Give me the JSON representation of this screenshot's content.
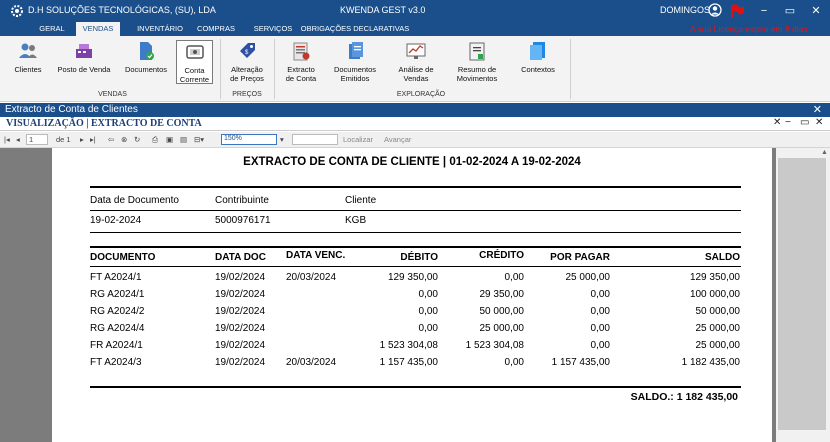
{
  "titlebar": {
    "company": "D.H SOLUÇÕES TECNOLÓGICAS, (SU), LDA",
    "app": "KWENDA GEST v3.0",
    "user": "DOMINGOS",
    "minimize": "−",
    "restore": "▭",
    "close": "✕"
  },
  "menu": {
    "tabs": [
      "GERAL",
      "VENDAS",
      "INVENTÁRIO",
      "COMPRAS",
      "SERVIÇOS",
      "OBRIGAÇÕES DECLARATIVAS"
    ],
    "active": "VENDAS",
    "license_warning": "A sua Licença expira em 8 dias"
  },
  "ribbon": {
    "buttons": [
      {
        "label": "Clientes",
        "icon": "users-icon"
      },
      {
        "label": "Posto de Venda",
        "icon": "cash-register-icon"
      },
      {
        "label": "Documentos",
        "icon": "document-check-icon"
      },
      {
        "label": "Conta\nCorrente",
        "icon": "current-account-icon"
      },
      {
        "label": "Alteração\nde Preços",
        "icon": "price-tag-icon"
      },
      {
        "label": "Extracto\nde Conta",
        "icon": "account-statement-icon"
      },
      {
        "label": "Documentos\nEmitidos",
        "icon": "issued-documents-icon"
      },
      {
        "label": "Análise de\nVendas",
        "icon": "sales-chart-icon"
      },
      {
        "label": "Resumo de\nMovimentos",
        "icon": "movements-summary-icon"
      },
      {
        "label": "Contextos",
        "icon": "contexts-icon"
      }
    ],
    "groups": [
      "VENDAS",
      "PREÇOS",
      "EXPLORAÇÃO"
    ]
  },
  "document_window": {
    "title": "Extracto de Conta de Clientes",
    "view_title": "VISUALIZAÇÃO | EXTRACTO DE CONTA",
    "close": "✕",
    "view_controls": [
      "✕",
      "−",
      "▭",
      "✕"
    ]
  },
  "report_toolbar": {
    "page_value": "1",
    "page_of": "de 1",
    "zoom": "150%",
    "find_label": "Localizar",
    "next_label": "Avançar"
  },
  "report": {
    "title": "EXTRACTO DE CONTA DE CLIENTE | 01-02-2024 A 19-02-2024",
    "info_headers": [
      "Data de Documento",
      "Contribuinte",
      "Cliente"
    ],
    "info_values": [
      "19-02-2024",
      "5000976171",
      "KGB"
    ],
    "columns": [
      "DOCUMENTO",
      "DATA DOC",
      "DATA VENC.",
      "DÉBITO",
      "CRÉDITO",
      "POR PAGAR",
      "SALDO"
    ],
    "rows": [
      [
        "FT A2024/1",
        "19/02/2024",
        "20/03/2024",
        "129 350,00",
        "0,00",
        "25 000,00",
        "129 350,00"
      ],
      [
        "RG A2024/1",
        "19/02/2024",
        "",
        "0,00",
        "29 350,00",
        "0,00",
        "100 000,00"
      ],
      [
        "RG A2024/2",
        "19/02/2024",
        "",
        "0,00",
        "50 000,00",
        "0,00",
        "50 000,00"
      ],
      [
        "RG A2024/4",
        "19/02/2024",
        "",
        "0,00",
        "25 000,00",
        "0,00",
        "25 000,00"
      ],
      [
        "FR A2024/1",
        "19/02/2024",
        "",
        "1 523 304,08",
        "1 523 304,08",
        "0,00",
        "25 000,00"
      ],
      [
        "FT A2024/3",
        "19/02/2024",
        "20/03/2024",
        "1 157 435,00",
        "0,00",
        "1 157 435,00",
        "1 182 435,00"
      ]
    ],
    "saldo": "SALDO.: 1 182 435,00"
  }
}
